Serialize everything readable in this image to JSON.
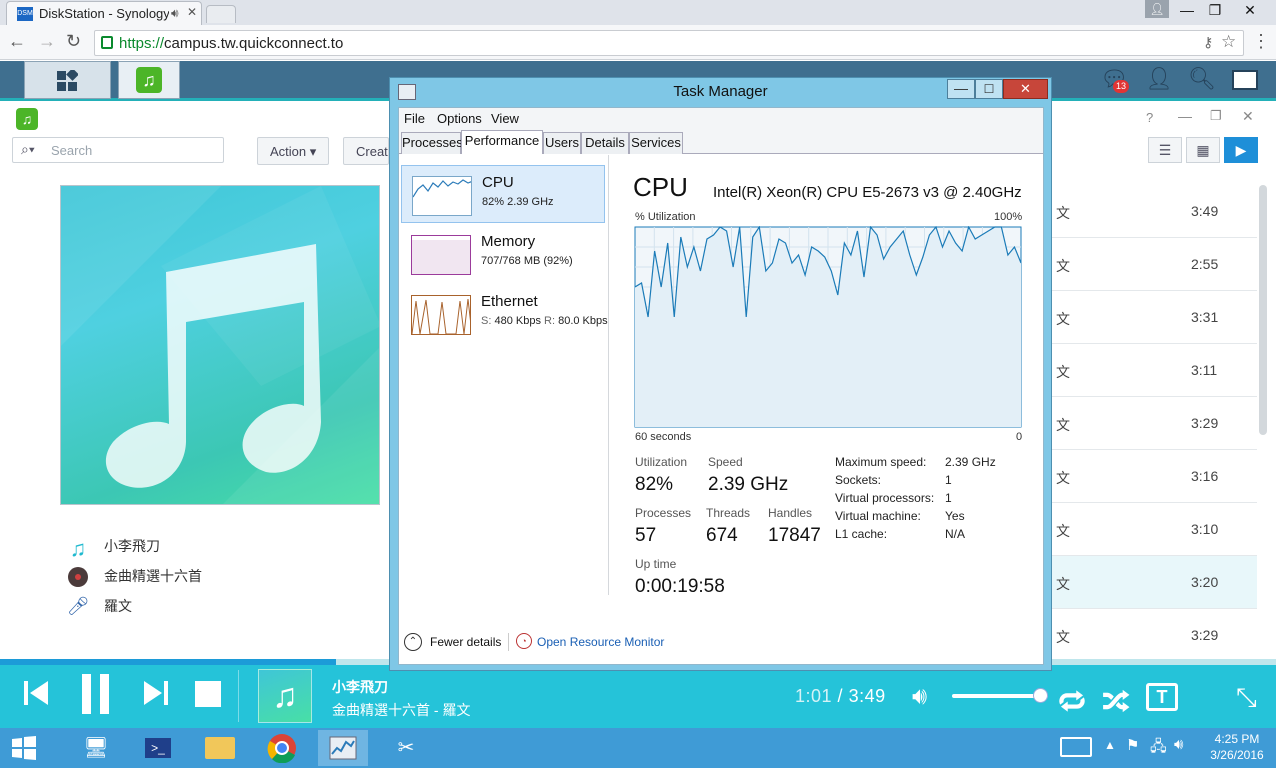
{
  "browser": {
    "tab_title": "DiskStation - Synology",
    "fav_text": "DSM",
    "url_secure": "https://",
    "url_rest": "campus.tw.quickconnect.to",
    "window_min": "—",
    "window_max": "❐",
    "window_close": "✕"
  },
  "dsm": {
    "notification_count": "13",
    "search_placeholder": "Search",
    "action_label": "Action ▾",
    "create_label": "Creat",
    "meta": {
      "song": "小李飛刀",
      "album": "金曲精選十六首",
      "artist": "羅文"
    },
    "songs": [
      {
        "artist": "文",
        "duration": "3:49"
      },
      {
        "artist": "文",
        "duration": "2:55"
      },
      {
        "artist": "文",
        "duration": "3:31"
      },
      {
        "artist": "文",
        "duration": "3:11"
      },
      {
        "artist": "文",
        "duration": "3:29"
      },
      {
        "artist": "文",
        "duration": "3:16"
      },
      {
        "artist": "文",
        "duration": "3:10"
      },
      {
        "artist": "文",
        "duration": "3:20"
      },
      {
        "artist": "文",
        "duration": "3:29"
      }
    ],
    "selected_row": 7
  },
  "player": {
    "title": "小李飛刀",
    "album_artist": "金曲精選十六首 - 羅文",
    "current_time": "1:01",
    "separator": " / ",
    "total_time": "3:49",
    "progress": 0.263,
    "volume": 0.92
  },
  "task_manager": {
    "title": "Task Manager",
    "menu": [
      "File",
      "Options",
      "View"
    ],
    "tabs": [
      "Processes",
      "Performance",
      "Users",
      "Details",
      "Services"
    ],
    "active_tab": "Performance",
    "resources": [
      {
        "name": "CPU",
        "value": "82%  2.39 GHz"
      },
      {
        "name": "Memory",
        "value": "707/768 MB (92%)"
      },
      {
        "name": "Ethernet",
        "value_s_label": "S:",
        "value_s": "480 Kbps",
        "value_r_label": "R:",
        "value_r": "80.0 Kbps"
      }
    ],
    "cpu_heading": "CPU",
    "cpu_model": "Intel(R) Xeon(R) CPU E5-2673 v3 @ 2.40GHz",
    "util_label": "% Utilization",
    "util_max": "100%",
    "axis_left": "60 seconds",
    "axis_right": "0",
    "stats": {
      "utilization_label": "Utilization",
      "utilization": "82%",
      "speed_label": "Speed",
      "speed": "2.39 GHz",
      "processes_label": "Processes",
      "processes": "57",
      "threads_label": "Threads",
      "threads": "674",
      "handles_label": "Handles",
      "handles": "17847",
      "uptime_label": "Up time",
      "uptime": "0:00:19:58"
    },
    "details": [
      {
        "k": "Maximum speed:",
        "v": "2.39 GHz"
      },
      {
        "k": "Sockets:",
        "v": "1"
      },
      {
        "k": "Virtual processors:",
        "v": "1"
      },
      {
        "k": "Virtual machine:",
        "v": "Yes"
      },
      {
        "k": "L1 cache:",
        "v": "N/A"
      }
    ],
    "fewer_details": "Fewer details",
    "open_monitor": "Open Resource Monitor"
  },
  "chart_data": {
    "type": "line",
    "title": "CPU",
    "xlabel": "60 seconds",
    "ylabel": "% Utilization",
    "ylim": [
      0,
      100
    ],
    "x": [
      0,
      1,
      2,
      3,
      4,
      5,
      6,
      7,
      8,
      9,
      10,
      11,
      12,
      13,
      14,
      15,
      16,
      17,
      18,
      19,
      20,
      21,
      22,
      23,
      24,
      25,
      26,
      27,
      28,
      29,
      30,
      31,
      32,
      33,
      34,
      35,
      36,
      37,
      38,
      39,
      40,
      41,
      42,
      43,
      44,
      45,
      46,
      47,
      48,
      49,
      50,
      51,
      52,
      53,
      54,
      55,
      56,
      57,
      58,
      59
    ],
    "y": [
      70,
      72,
      55,
      88,
      70,
      92,
      55,
      95,
      80,
      90,
      78,
      94,
      96,
      100,
      98,
      80,
      100,
      55,
      95,
      100,
      78,
      82,
      94,
      92,
      82,
      86,
      76,
      90,
      88,
      85,
      78,
      66,
      92,
      86,
      98,
      75,
      100,
      96,
      84,
      90,
      94,
      98,
      86,
      76,
      85,
      96,
      100,
      90,
      98,
      92,
      88,
      100,
      94,
      96,
      98,
      100,
      100,
      86,
      90,
      82
    ],
    "grid": true
  },
  "taskbar": {
    "time": "4:25 PM",
    "date": "3/26/2016"
  }
}
